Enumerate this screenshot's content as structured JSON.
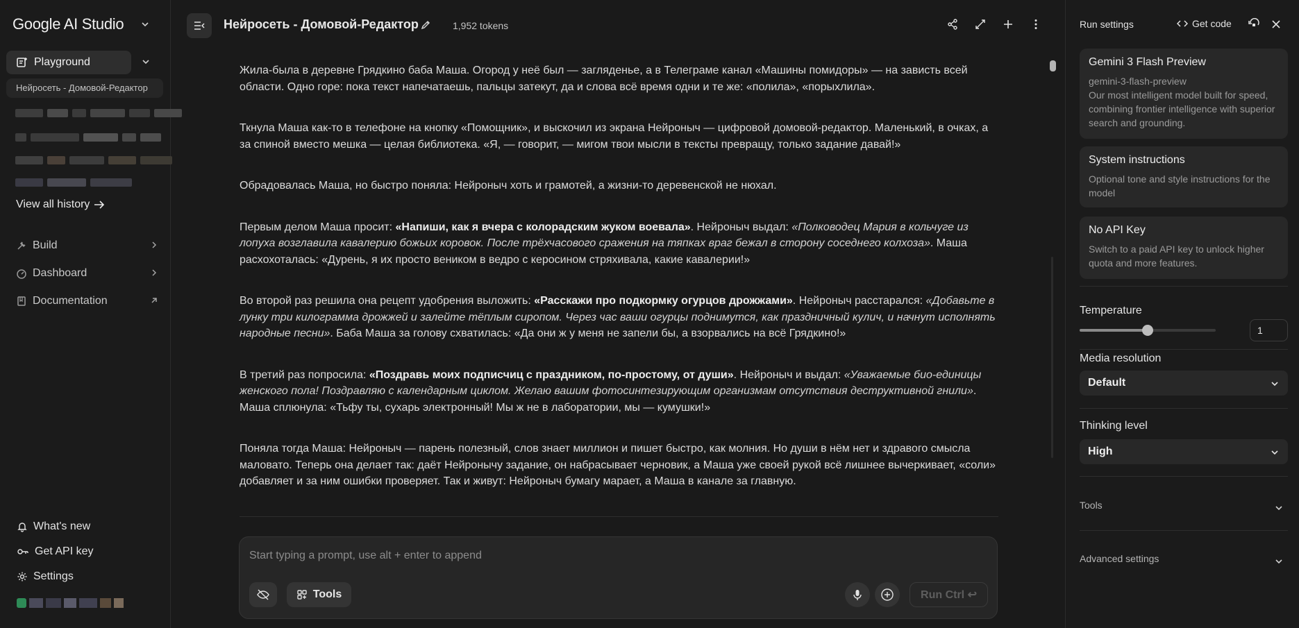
{
  "sidebar": {
    "brand": "Google AI Studio",
    "playground_label": "Playground",
    "active_chat": "Нейросеть - Домовой-Редактор",
    "view_history": "View all history",
    "nav": [
      {
        "label": "Build",
        "icon": "build-icon"
      },
      {
        "label": "Dashboard",
        "icon": "dashboard-icon"
      },
      {
        "label": "Documentation",
        "icon": "documentation-icon"
      }
    ],
    "bottom": [
      {
        "label": "What's new",
        "icon": "bell-icon"
      },
      {
        "label": "Get API key",
        "icon": "key-icon"
      },
      {
        "label": "Settings",
        "icon": "gear-icon"
      }
    ]
  },
  "header": {
    "title": "Нейросеть - Домовой-Редактор",
    "tokens": "1,952 tokens"
  },
  "content": {
    "paragraphs": [
      {
        "parts": [
          {
            "t": "Жила-была в деревне Грядкино баба Маша. Огород у неё был — загляденье, а в Телеграме канал «Машины помидоры» — на зависть всей области. Одно горе: пока текст напечатаешь, пальцы затекут, да и слова всё время одни и те же: «полила», «порыхлила»."
          }
        ]
      },
      {
        "parts": [
          {
            "t": "Ткнула Маша как-то в телефоне на кнопку «Помощник», и выскочил из экрана Нейроныч — цифровой домовой-редактор. Маленький, в очках, а за спиной вместо мешка — целая библиотека. «Я, — говорит, — мигом твои мысли в тексты превращу, только задание давай!»"
          }
        ]
      },
      {
        "parts": [
          {
            "t": "Обрадовалась Маша, но быстро поняла: Нейроныч хоть и грамотей, а жизни-то деревенской не нюхал."
          }
        ]
      },
      {
        "parts": [
          {
            "t": "Первым делом Маша просит: "
          },
          {
            "t": "«Напиши, как я вчера с колорадским жуком воевала»",
            "b": true
          },
          {
            "t": ". Нейроныч выдал: "
          },
          {
            "t": "«Полководец Мария в кольчуге из лопуха возглавила кавалерию божьих коровок. После трёхчасового сражения на тяпках враг бежал в сторону соседнего колхоза»",
            "i": true
          },
          {
            "t": ". Маша расхохоталась: «Дурень, я их просто веником в ведро с керосином стряхивала, какие кавалерии!»"
          }
        ]
      },
      {
        "parts": [
          {
            "t": "Во второй раз решила она рецепт удобрения выложить: "
          },
          {
            "t": "«Расскажи про подкормку огурцов дрожжами»",
            "b": true
          },
          {
            "t": ". Нейроныч расстарался: "
          },
          {
            "t": "«Добавьте в лунку три килограмма дрожжей и залейте тёплым сиропом. Через час ваши огурцы поднимутся, как праздничный кулич, и начнут исполнять народные песни»",
            "i": true
          },
          {
            "t": ". Баба Маша за голову схватилась: «Да они ж у меня не запели бы, а взорвались на всё Грядкино!»"
          }
        ]
      },
      {
        "parts": [
          {
            "t": "В третий раз попросила: "
          },
          {
            "t": "«Поздравь моих подписчиц с праздником, по-простому, от души»",
            "b": true
          },
          {
            "t": ". Нейроныч и выдал: "
          },
          {
            "t": "«Уважаемые био-единицы женского пола! Поздравляю с календарным циклом. Желаю вашим фотосинтезирующим организмам отсутствия деструктивной гнили»",
            "i": true
          },
          {
            "t": ". Маша сплюнула: «Тьфу ты, сухарь электронный! Мы ж не в лаборатории, мы — кумушки!»"
          }
        ]
      },
      {
        "parts": [
          {
            "t": "Поняла тогда Маша: Нейроныч — парень полезный, слов знает миллион и пишет быстро, как молния. Но души в нём нет и здравого смысла маловато. Теперь она делает так: даёт Нейронычу задание, он набрасывает черновик, а Маша уже своей рукой всё лишнее вычеркивает, «соли» добавляет и за ним ошибки проверяет. Так и живут: Нейроныч бумагу марает, а Маша в канале за главную."
          }
        ]
      }
    ]
  },
  "prompt": {
    "placeholder": "Start typing a prompt, use alt + enter to append",
    "tools_label": "Tools",
    "run_label": "Run Ctrl ↩"
  },
  "run_settings": {
    "title": "Run settings",
    "get_code": "Get code",
    "model": {
      "name": "Gemini 3 Flash Preview",
      "id": "gemini-3-flash-preview",
      "description": "Our most intelligent model built for speed, combining frontier intelligence with superior search and grounding."
    },
    "system_instructions": {
      "title": "System instructions",
      "description": "Optional tone and style instructions for the model"
    },
    "api_key": {
      "title": "No API Key",
      "description": "Switch to a paid API key to unlock higher quota and more features."
    },
    "temperature": {
      "label": "Temperature",
      "value": "1",
      "fraction": 0.5
    },
    "media_resolution": {
      "label": "Media resolution",
      "value": "Default"
    },
    "thinking_level": {
      "label": "Thinking level",
      "value": "High"
    },
    "tools_label": "Tools",
    "advanced_label": "Advanced settings"
  }
}
